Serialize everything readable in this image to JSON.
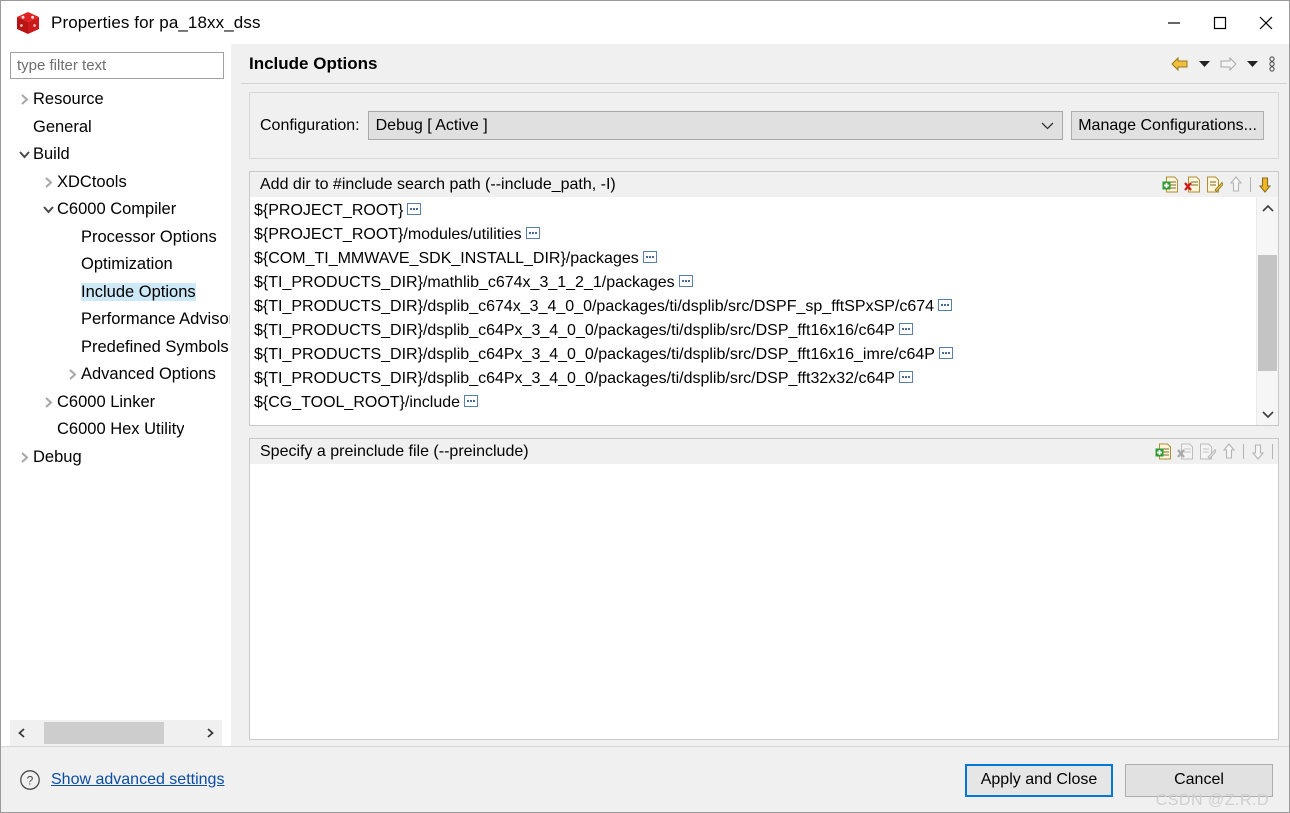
{
  "window": {
    "title": "Properties for pa_18xx_dss",
    "app_icon": "red-cube-icon",
    "controls": {
      "minimize": "minimize-icon",
      "maximize": "maximize-icon",
      "close": "close-icon"
    }
  },
  "sidebar": {
    "filter": {
      "placeholder": "type filter text",
      "value": ""
    },
    "items": [
      {
        "label": "Resource",
        "level": 0,
        "twisty": "collapsed",
        "selected": false
      },
      {
        "label": "General",
        "level": 0,
        "twisty": "none",
        "selected": false
      },
      {
        "label": "Build",
        "level": 0,
        "twisty": "expanded",
        "selected": false
      },
      {
        "label": "XDCtools",
        "level": 1,
        "twisty": "collapsed",
        "selected": false
      },
      {
        "label": "C6000 Compiler",
        "level": 1,
        "twisty": "expanded",
        "selected": false
      },
      {
        "label": "Processor Options",
        "level": 2,
        "twisty": "none",
        "selected": false
      },
      {
        "label": "Optimization",
        "level": 2,
        "twisty": "none",
        "selected": false
      },
      {
        "label": "Include Options",
        "level": 2,
        "twisty": "none",
        "selected": true
      },
      {
        "label": "Performance Advisor",
        "level": 2,
        "twisty": "none",
        "selected": false
      },
      {
        "label": "Predefined Symbols",
        "level": 2,
        "twisty": "none",
        "selected": false
      },
      {
        "label": "Advanced Options",
        "level": 2,
        "twisty": "collapsed",
        "selected": false
      },
      {
        "label": "C6000 Linker",
        "level": 1,
        "twisty": "collapsed",
        "selected": false
      },
      {
        "label": "C6000 Hex Utility",
        "level": 1,
        "twisty": "none",
        "selected": false
      },
      {
        "label": "Debug",
        "level": 0,
        "twisty": "collapsed",
        "selected": false
      }
    ],
    "hscrollbar": {
      "left_arrow": "chevron-left-icon",
      "right_arrow": "chevron-right-icon"
    }
  },
  "page": {
    "title": "Include Options",
    "header_tools": [
      {
        "name": "back-arrow-icon",
        "enabled": true
      },
      {
        "name": "back-dropdown-icon",
        "enabled": true
      },
      {
        "name": "forward-arrow-icon",
        "enabled": false
      },
      {
        "name": "forward-dropdown-icon",
        "enabled": true
      },
      {
        "name": "view-menu-icon",
        "enabled": true
      }
    ]
  },
  "configuration": {
    "label": "Configuration:",
    "value": "Debug  [ Active ]",
    "dropdown_icon": "chevron-down-icon",
    "manage_button": "Manage Configurations..."
  },
  "include_paths_panel": {
    "label": "Add dir to #include search path (--include_path, -I)",
    "tools": [
      {
        "name": "add-icon",
        "enabled": true
      },
      {
        "name": "delete-icon",
        "enabled": true
      },
      {
        "name": "edit-icon",
        "enabled": true
      },
      {
        "name": "move-up-icon",
        "enabled": false
      },
      {
        "name": "move-down-icon",
        "enabled": true
      }
    ],
    "items": [
      "${PROJECT_ROOT}",
      "${PROJECT_ROOT}/modules/utilities",
      "${COM_TI_MMWAVE_SDK_INSTALL_DIR}/packages",
      "${TI_PRODUCTS_DIR}/mathlib_c674x_3_1_2_1/packages",
      "${TI_PRODUCTS_DIR}/dsplib_c674x_3_4_0_0/packages/ti/dsplib/src/DSPF_sp_fftSPxSP/c674",
      "${TI_PRODUCTS_DIR}/dsplib_c64Px_3_4_0_0/packages/ti/dsplib/src/DSP_fft16x16/c64P",
      "${TI_PRODUCTS_DIR}/dsplib_c64Px_3_4_0_0/packages/ti/dsplib/src/DSP_fft16x16_imre/c64P",
      "${TI_PRODUCTS_DIR}/dsplib_c64Px_3_4_0_0/packages/ti/dsplib/src/DSP_fft32x32/c64P",
      "${CG_TOOL_ROOT}/include"
    ],
    "item_badge": "ellipsis-badge-icon",
    "scrollbar": {
      "up_arrow": "chevron-up-icon",
      "down_arrow": "chevron-down-icon"
    }
  },
  "preinclude_panel": {
    "label": "Specify a preinclude file (--preinclude)",
    "tools": [
      {
        "name": "add-icon",
        "enabled": true
      },
      {
        "name": "delete-icon",
        "enabled": false
      },
      {
        "name": "edit-icon",
        "enabled": false
      },
      {
        "name": "move-up-icon",
        "enabled": false
      },
      {
        "name": "move-down-icon",
        "enabled": false
      }
    ],
    "items": []
  },
  "footer": {
    "help_icon": "help-icon",
    "advanced_link": "Show advanced settings",
    "apply_button": "Apply and Close",
    "cancel_button": "Cancel"
  },
  "watermark": "CSDN @Z.R.D"
}
